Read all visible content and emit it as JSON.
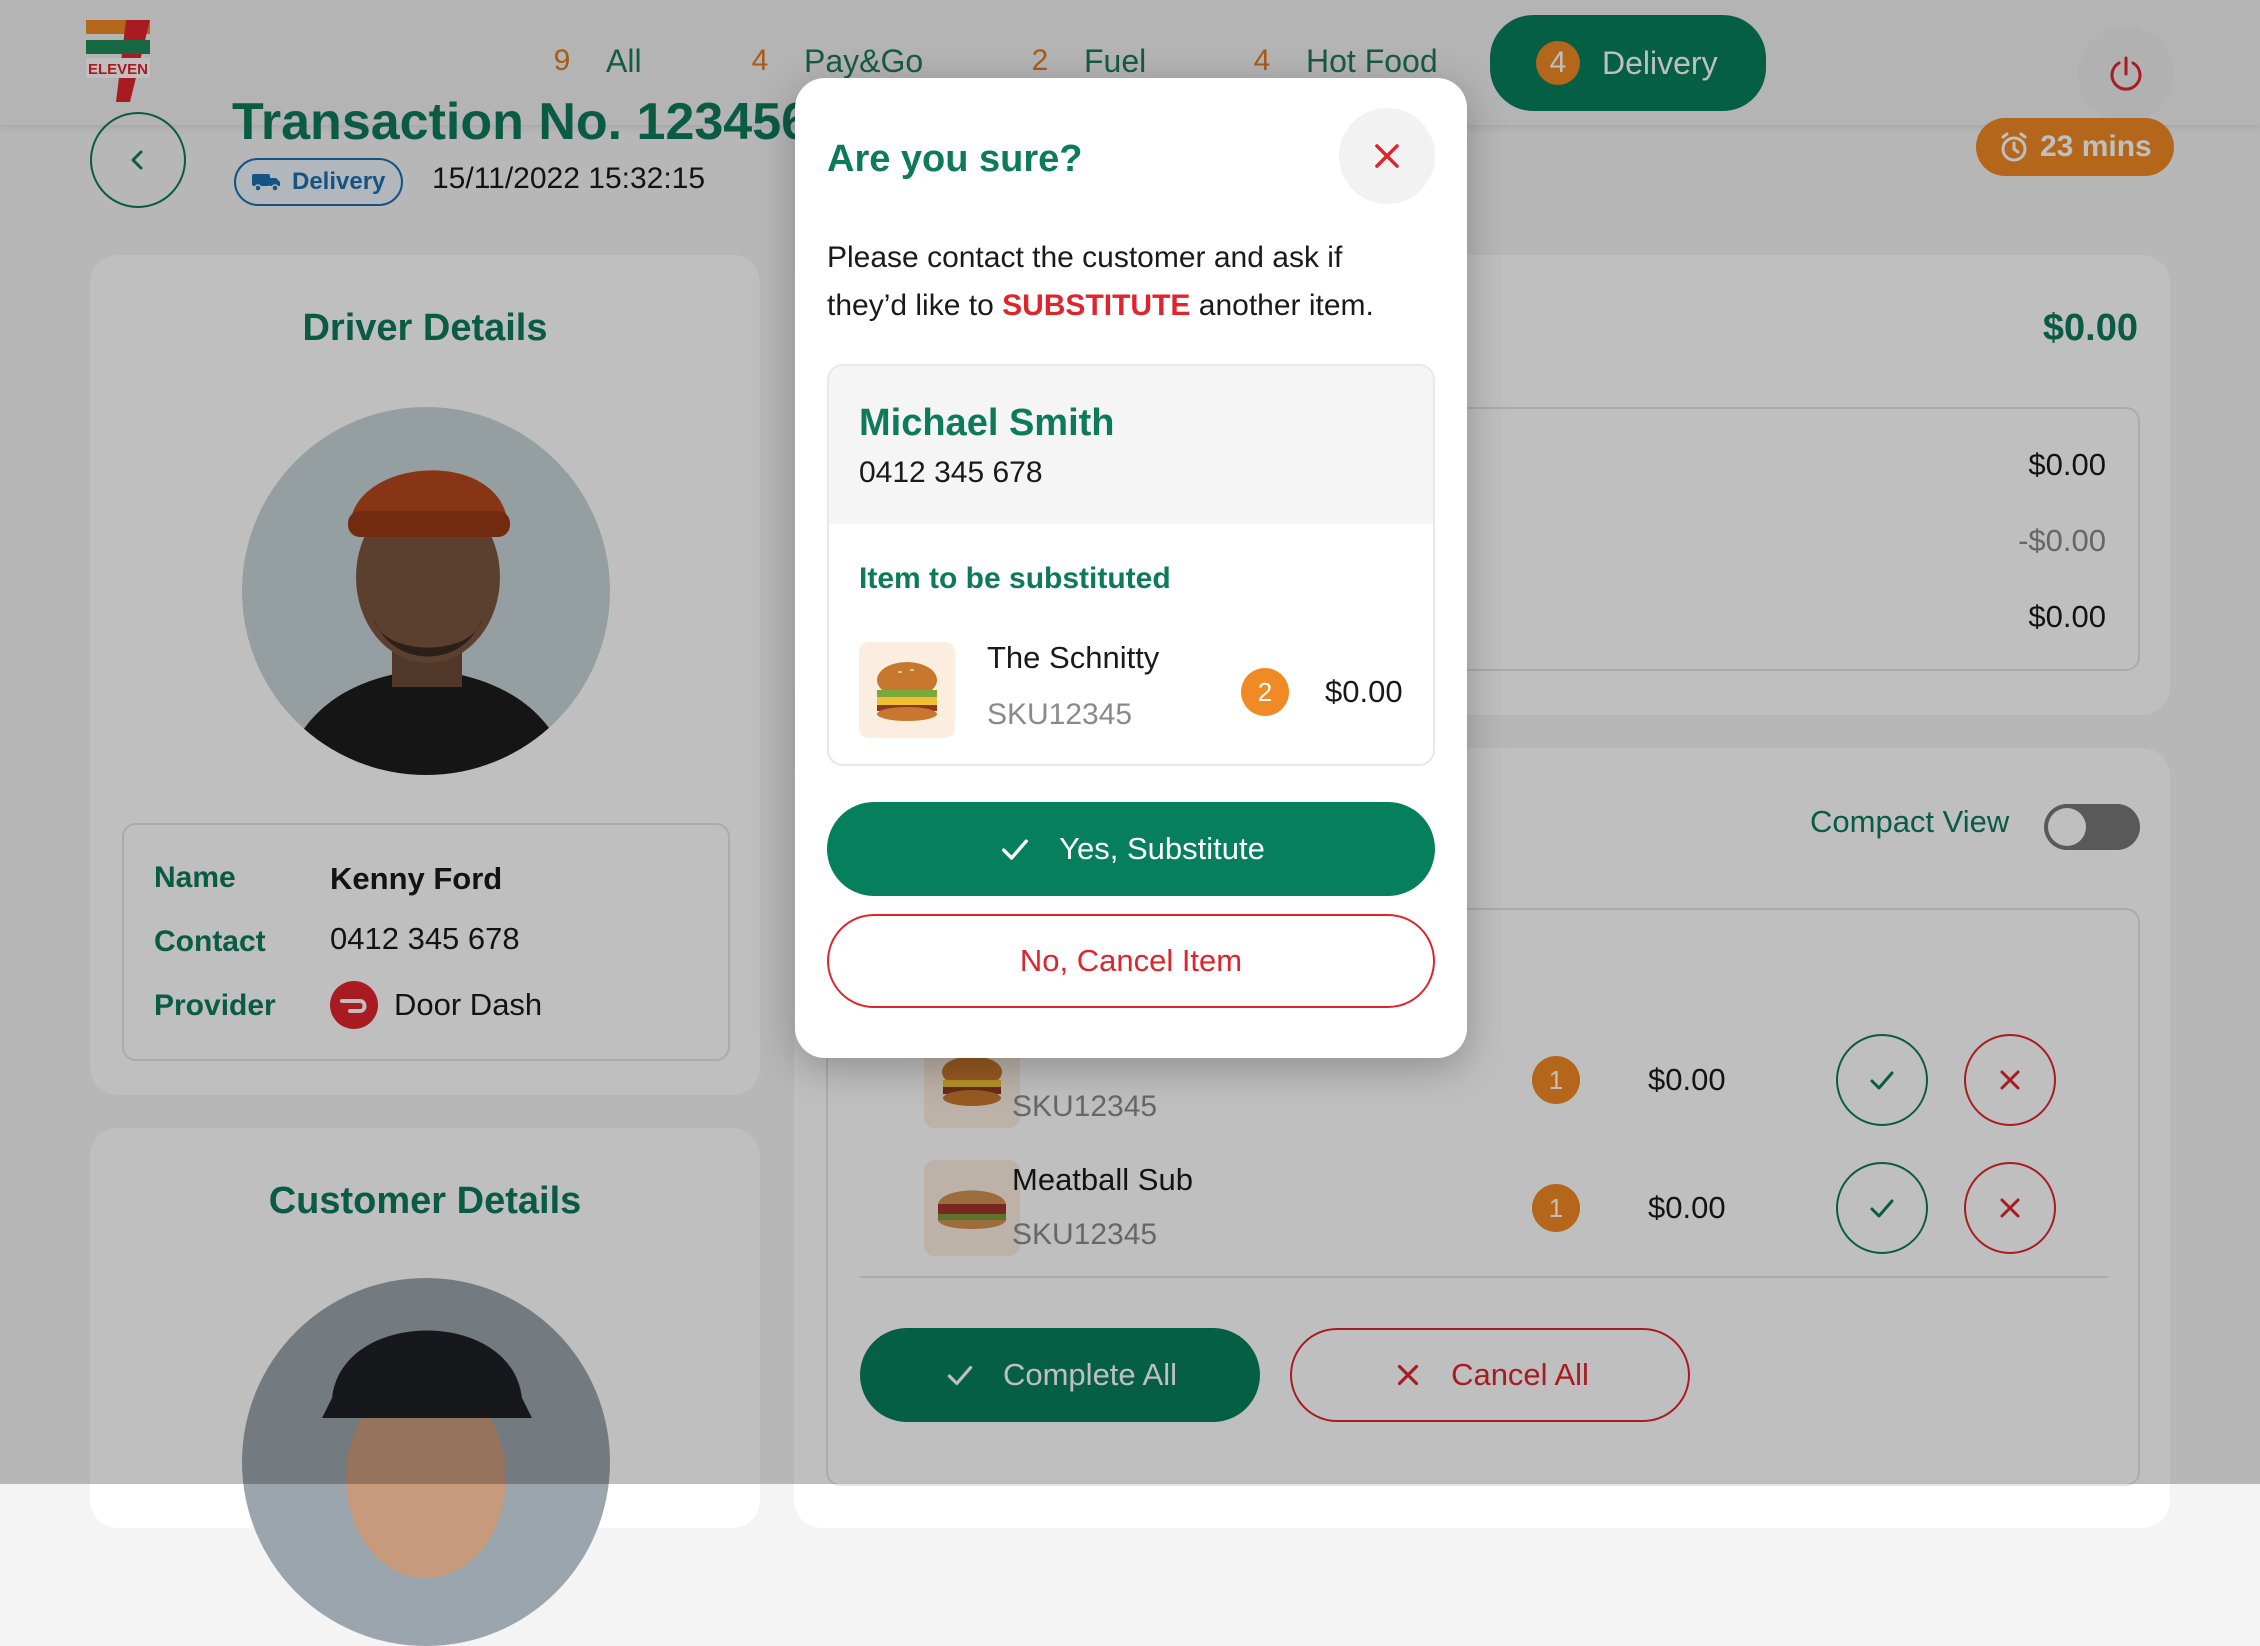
{
  "brand": {
    "name": "7-Eleven",
    "logo_text": "ELEVEN",
    "logo_digit": "7"
  },
  "colors": {
    "primary": "#067f5c",
    "accent": "#f08a24",
    "danger": "#e0242c",
    "info": "#1d6fb0"
  },
  "nav": {
    "tabs": [
      {
        "count": "9",
        "label": "All"
      },
      {
        "count": "4",
        "label": "Pay&Go"
      },
      {
        "count": "2",
        "label": "Fuel"
      },
      {
        "count": "4",
        "label": "Hot Food"
      },
      {
        "count": "4",
        "label": "Delivery",
        "active": true
      }
    ],
    "power_icon": "power-icon"
  },
  "header": {
    "title": "Transaction No. 1234567",
    "type_badge": "Delivery",
    "datetime": "15/11/2022 15:32:15",
    "timer": "23 mins"
  },
  "driver": {
    "heading": "Driver Details",
    "name_label": "Name",
    "name": "Kenny Ford",
    "contact_label": "Contact",
    "contact": "0412 345 678",
    "provider_label": "Provider",
    "provider": "Door Dash"
  },
  "customer": {
    "heading": "Customer Details"
  },
  "summary": {
    "total": "$0.00",
    "lines": [
      "$0.00",
      "-$0.00",
      "$0.00"
    ]
  },
  "items_panel": {
    "compact_view_label": "Compact View",
    "items": [
      {
        "name": "",
        "sku": "SKU12345",
        "qty": "1",
        "price": "$0.00"
      },
      {
        "name": "Meatball Sub",
        "sku": "SKU12345",
        "qty": "1",
        "price": "$0.00"
      }
    ],
    "complete_all": "Complete All",
    "cancel_all": "Cancel All"
  },
  "modal": {
    "title": "Are you sure?",
    "message_pre": "Please contact the customer and ask if they’d like to ",
    "message_highlight": "SUBSTITUTE",
    "message_post": " another item.",
    "customer_name": "Michael Smith",
    "customer_phone": "0412 345 678",
    "item_heading": "Item to be substituted",
    "item": {
      "name": "The Schnitty",
      "sku": "SKU12345",
      "qty": "2",
      "price": "$0.00"
    },
    "confirm_label": "Yes, Substitute",
    "cancel_label": "No, Cancel Item"
  }
}
